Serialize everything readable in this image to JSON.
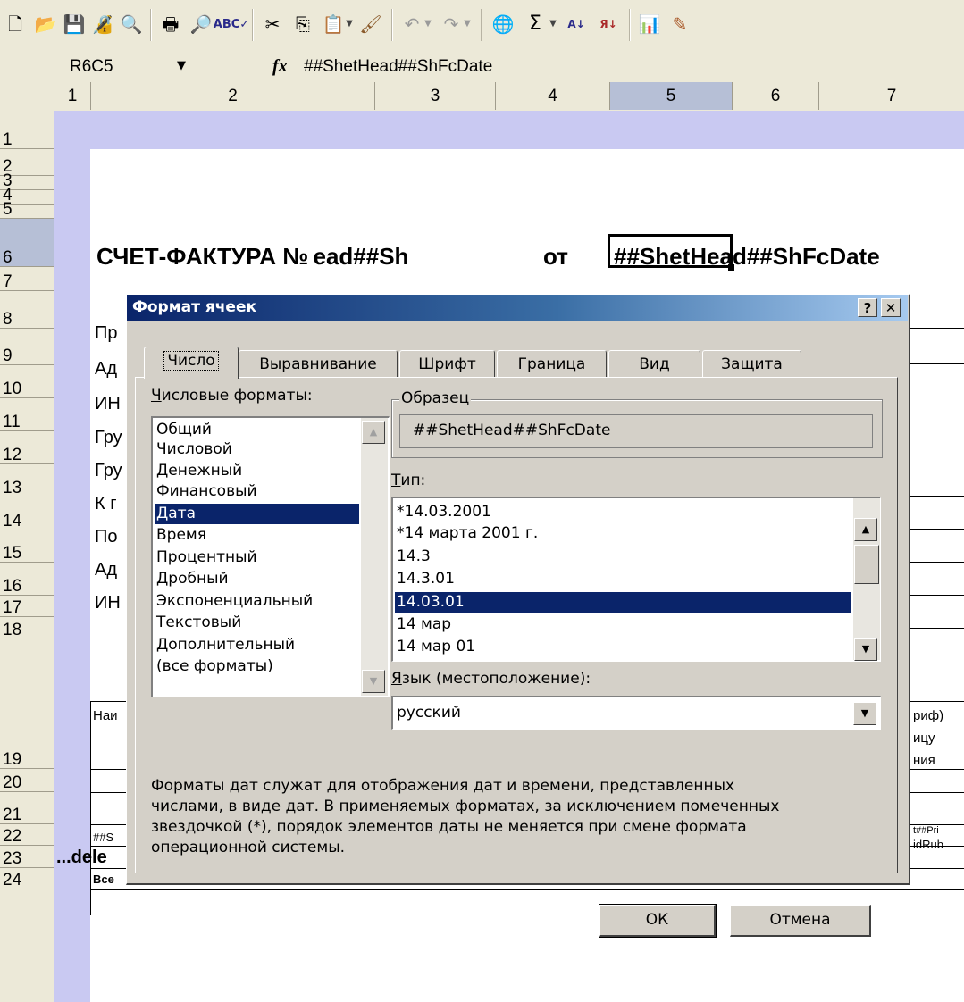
{
  "toolbar": {
    "icons": [
      "new-icon",
      "open-icon",
      "save-icon",
      "permission-icon",
      "research-icon",
      "print-icon",
      "print-preview-icon",
      "spelling-icon",
      "cut-icon",
      "copy-icon",
      "paste-icon",
      "format-painter-icon",
      "undo-icon",
      "redo-icon",
      "hyperlink-icon",
      "autosum-icon",
      "sort-ascending-icon",
      "sort-descending-icon",
      "chart-wizard-icon",
      "drawing-icon"
    ]
  },
  "formula_bar": {
    "name_box": "R6C5",
    "fx": "fx",
    "content": "##ShetHead##ShFcDate"
  },
  "columns": [
    "1",
    "2",
    "3",
    "4",
    "5",
    "6",
    "7"
  ],
  "selected_column": "5",
  "rows": [
    "1",
    "2",
    "3",
    "4",
    "5",
    "6",
    "7",
    "8",
    "9",
    "10",
    "11",
    "12",
    "13",
    "14",
    "15",
    "16",
    "17",
    "18",
    "19",
    "20",
    "21",
    "22",
    "23",
    "24"
  ],
  "selected_row": "6",
  "sheet": {
    "title": "СЧЕТ-ФАКТУРА № ",
    "title_clipped": "ead##Sh",
    "ot": "от",
    "date_cell": "##ShetHead##ShFcDate",
    "row_labels": [
      "Пр",
      "Ад",
      "ИН",
      "Гру",
      "Гру",
      "К г",
      "По",
      "Ад",
      "ИН"
    ],
    "table_header_left": "Наи",
    "right_frag1": "риф)",
    "right_frag2": "ицу",
    "right_frag3": "ния",
    "row21_left": "##S",
    "row21_right_a": "t##Pri",
    "row21_right_b": "idRub",
    "row22_left": "...dele",
    "row23_left": "Все"
  },
  "dialog": {
    "title": "Формат ячеек",
    "help": "?",
    "close": "✕",
    "tabs": [
      "Число",
      "Выравнивание",
      "Шрифт",
      "Граница",
      "Вид",
      "Защита"
    ],
    "active_tab": "Число",
    "category_label": "Числовые форматы:",
    "categories": [
      "Общий",
      "Числовой",
      "Денежный",
      "Финансовый",
      "Дата",
      "Время",
      "Процентный",
      "Дробный",
      "Экспоненциальный",
      "Текстовый",
      "Дополнительный",
      "(все форматы)"
    ],
    "selected_category": "Дата",
    "sample_legend": "Образец",
    "sample_value": "##ShetHead##ShFcDate",
    "type_label": "Тип:",
    "types": [
      "*14.03.2001",
      "*14 марта 2001 г.",
      "14.3",
      "14.3.01",
      "14.03.01",
      "14 мар",
      "14 мар 01"
    ],
    "selected_type": "14.03.01",
    "locale_label": "Язык (местоположение):",
    "locale_value": "русский",
    "description": [
      "Форматы дат служат для отображения дат и времени, представленных",
      "числами, в виде дат. В применяемых форматах, за исключением помеченных",
      "звездочкой (*), порядок элементов даты не меняется при смене формата",
      "операционной системы."
    ],
    "ok": "ОК",
    "cancel": "Отмена"
  },
  "colors": {
    "selection": "#0a246a",
    "title_bar_start": "#0a246a",
    "title_bar_end": "#a6caf0",
    "sheet_band": "#c9c9f2",
    "header_highlight": "#b6bfd6",
    "dialog_face": "#d4d0c8"
  }
}
